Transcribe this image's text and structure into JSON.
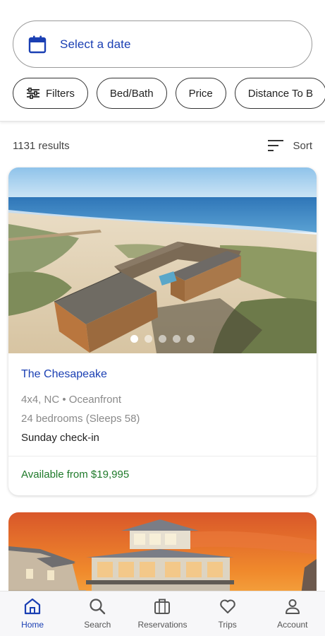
{
  "search": {
    "date_placeholder": "Select a date"
  },
  "filters": {
    "chips": [
      {
        "label": "Filters",
        "icon": "sliders-icon"
      },
      {
        "label": "Bed/Bath"
      },
      {
        "label": "Price"
      },
      {
        "label": "Distance To B"
      }
    ]
  },
  "results": {
    "count": "1131 results",
    "sort_label": "Sort"
  },
  "listings": [
    {
      "name": "The Chesapeake",
      "details": "4x4, NC • Oceanfront",
      "bedrooms": "24 bedrooms (Sleeps 58)",
      "checkin": "Sunday check-in",
      "price": "Available from $19,995",
      "photo_count": 5,
      "active_photo": 0
    }
  ],
  "nav": {
    "items": [
      {
        "label": "Home",
        "icon": "home-icon",
        "active": true
      },
      {
        "label": "Search",
        "icon": "search-icon",
        "active": false
      },
      {
        "label": "Reservations",
        "icon": "suitcase-icon",
        "active": false
      },
      {
        "label": "Trips",
        "icon": "heart-icon",
        "active": false
      },
      {
        "label": "Account",
        "icon": "person-icon",
        "active": false
      }
    ]
  },
  "colors": {
    "accent": "#1a3fb3",
    "price_green": "#1f7a2a"
  }
}
